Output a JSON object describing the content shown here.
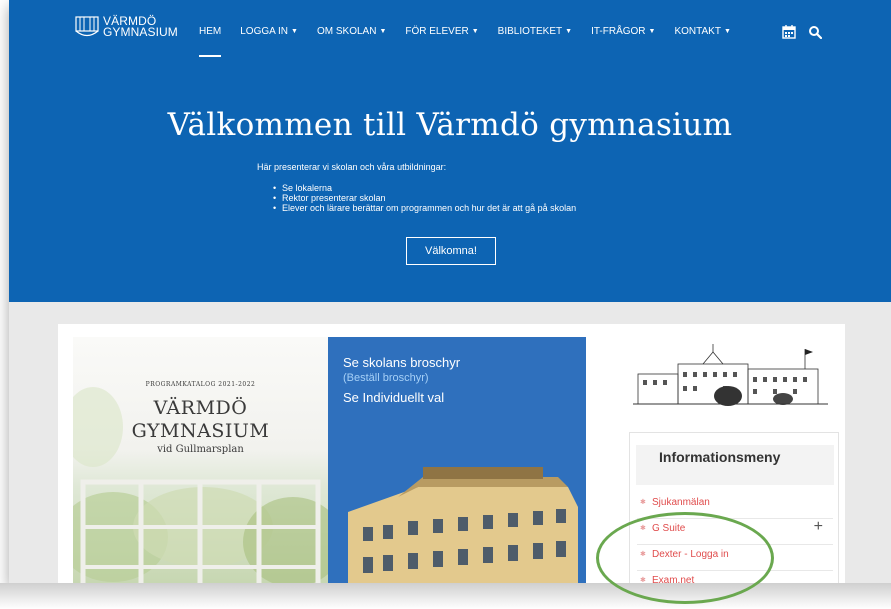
{
  "brand": {
    "line1": "VÄRMDÖ",
    "line2": "GYMNASIUM",
    "colors": {
      "primary": "#0d64b3",
      "link_red": "#e04c4c",
      "annotation": "#6aa84f"
    }
  },
  "nav": {
    "items": [
      {
        "label": "HEM",
        "active": true,
        "dropdown": false
      },
      {
        "label": "LOGGA IN",
        "dropdown": true
      },
      {
        "label": "OM SKOLAN",
        "dropdown": true
      },
      {
        "label": "FÖR ELEVER",
        "dropdown": true
      },
      {
        "label": "BIBLIOTEKET",
        "dropdown": true
      },
      {
        "label": "IT-FRÅGOR",
        "dropdown": true
      },
      {
        "label": "KONTAKT",
        "dropdown": true
      }
    ],
    "icons": [
      "calendar-icon",
      "search-icon"
    ]
  },
  "hero": {
    "title": "Välkommen till Värmdö gymnasium",
    "intro": "Här presenterar vi skolan och våra utbildningar:",
    "bullets": [
      "Se lokalerna",
      "Rektor presenterar skolan",
      "Elever och lärare berättar om programmen och hur det är att gå på skolan"
    ],
    "button": "Välkomna!"
  },
  "brochure": {
    "catalog": "PROGRAMKATALOG 2021-2022",
    "name_line1": "VÄRMDÖ",
    "name_line2": "GYMNASIUM",
    "subtitle": "vid Gullmarsplan"
  },
  "broschyr_panel": {
    "link1": "Se skolans broschyr",
    "link2": "(Beställ broschyr)",
    "link3": "Se Individuellt val"
  },
  "info_menu": {
    "title": "Informationsmeny",
    "items": [
      "Sjukanmälan",
      "G Suite",
      "Dexter - Logga in",
      "Exam.net"
    ],
    "expand_symbol": "+"
  }
}
